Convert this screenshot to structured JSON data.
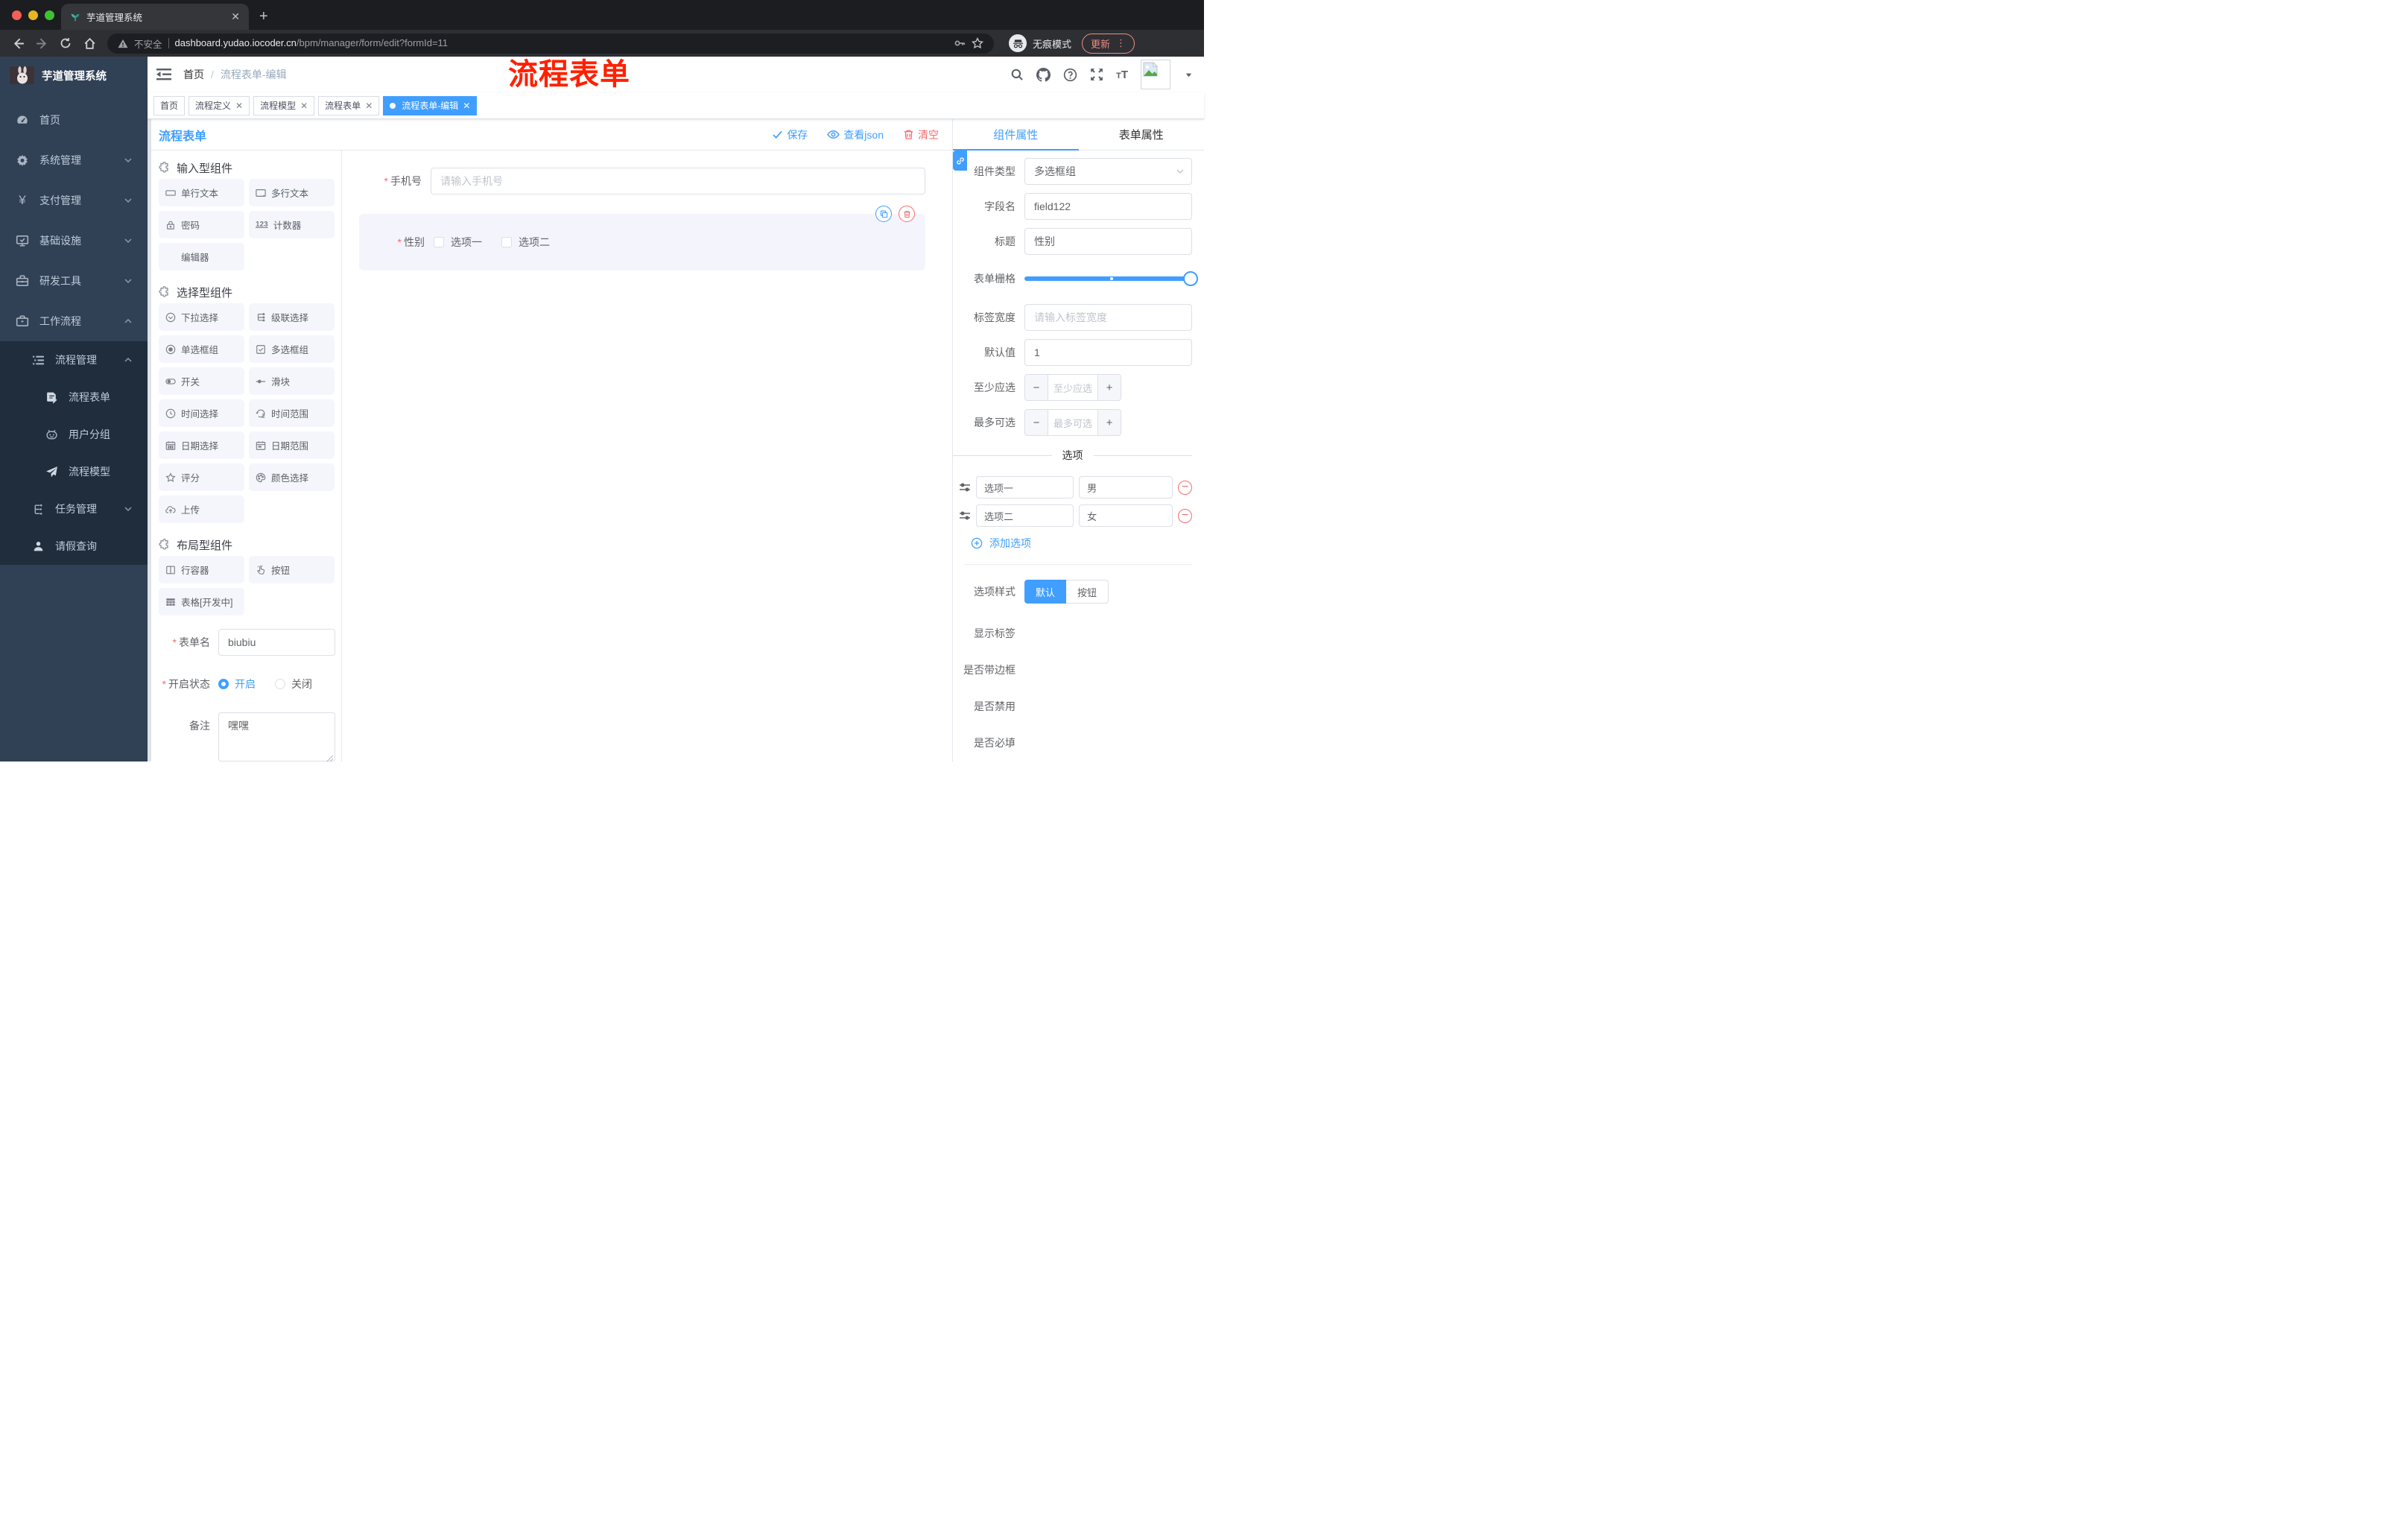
{
  "browser": {
    "tab_title": "芋道管理系统",
    "new_tab": "+",
    "security_label": "不安全",
    "url_host": "dashboard.yudao.iocoder.cn",
    "url_path": "/bpm/manager/form/edit?formId=11",
    "incognito_label": "无痕模式",
    "update_label": "更新"
  },
  "sidebar": {
    "logo_title": "芋道管理系统",
    "items": [
      {
        "label": "首页"
      },
      {
        "label": "系统管理"
      },
      {
        "label": "支付管理"
      },
      {
        "label": "基础设施"
      },
      {
        "label": "研发工具"
      },
      {
        "label": "工作流程"
      },
      {
        "label": "流程管理"
      },
      {
        "label": "流程表单"
      },
      {
        "label": "用户分组"
      },
      {
        "label": "流程模型"
      },
      {
        "label": "任务管理"
      },
      {
        "label": "请假查询"
      }
    ]
  },
  "header": {
    "breadcrumb_home": "首页",
    "breadcrumb_sep": "/",
    "breadcrumb_current": "流程表单-编辑",
    "annotation": "流程表单",
    "annotation_color": "#ff2000"
  },
  "tags": [
    {
      "label": "首页"
    },
    {
      "label": "流程定义"
    },
    {
      "label": "流程模型"
    },
    {
      "label": "流程表单"
    },
    {
      "label": "流程表单-编辑"
    }
  ],
  "designer": {
    "title": "流程表单",
    "actions": {
      "save": "保存",
      "view_json": "查看json",
      "clear": "清空"
    },
    "sections": [
      {
        "title": "输入型组件",
        "items": [
          "单行文本",
          "多行文本",
          "密码",
          "计数器",
          "编辑器"
        ]
      },
      {
        "title": "选择型组件",
        "items": [
          "下拉选择",
          "级联选择",
          "单选框组",
          "多选框组",
          "开关",
          "滑块",
          "时间选择",
          "时间范围",
          "日期选择",
          "日期范围",
          "评分",
          "颜色选择",
          "上传"
        ]
      },
      {
        "title": "布局型组件",
        "items": [
          "行容器",
          "按钮",
          "表格[开发中]"
        ]
      }
    ],
    "form": {
      "name_label": "表单名",
      "name_value": "biubiu",
      "status_label": "开启状态",
      "status_on": "开启",
      "status_off": "关闭",
      "remark_label": "备注",
      "remark_value": "嘿嘿"
    }
  },
  "canvas": {
    "phone": {
      "label": "手机号",
      "placeholder": "请输入手机号"
    },
    "gender": {
      "label": "性别",
      "option1": "选项一",
      "option2": "选项二"
    }
  },
  "props": {
    "tab_component": "组件属性",
    "tab_form": "表单属性",
    "fields": {
      "type_label": "组件类型",
      "type_value": "多选框组",
      "field_label": "字段名",
      "field_value": "field122",
      "title_label": "标题",
      "title_value": "性别",
      "grid_label": "表单栅格",
      "width_label": "标签宽度",
      "width_placeholder": "请输入标签宽度",
      "default_label": "默认值",
      "default_value": "1",
      "min_label": "至少应选",
      "min_placeholder": "至少应选",
      "max_label": "最多可选",
      "max_placeholder": "最多可选"
    },
    "options": {
      "divider": "选项",
      "rows": [
        {
          "label": "选项一",
          "value": "男"
        },
        {
          "label": "选项二",
          "value": "女"
        }
      ],
      "add": "添加选项"
    },
    "style": {
      "label": "选项样式",
      "opt_default": "默认",
      "opt_button": "按钮"
    },
    "switches": [
      {
        "label": "显示标签"
      },
      {
        "label": "是否带边框"
      },
      {
        "label": "是否禁用"
      },
      {
        "label": "是否必填"
      }
    ]
  },
  "colors": {
    "accent": "#409EFF",
    "danger": "#F56C6C",
    "sidebar": "#304156"
  }
}
